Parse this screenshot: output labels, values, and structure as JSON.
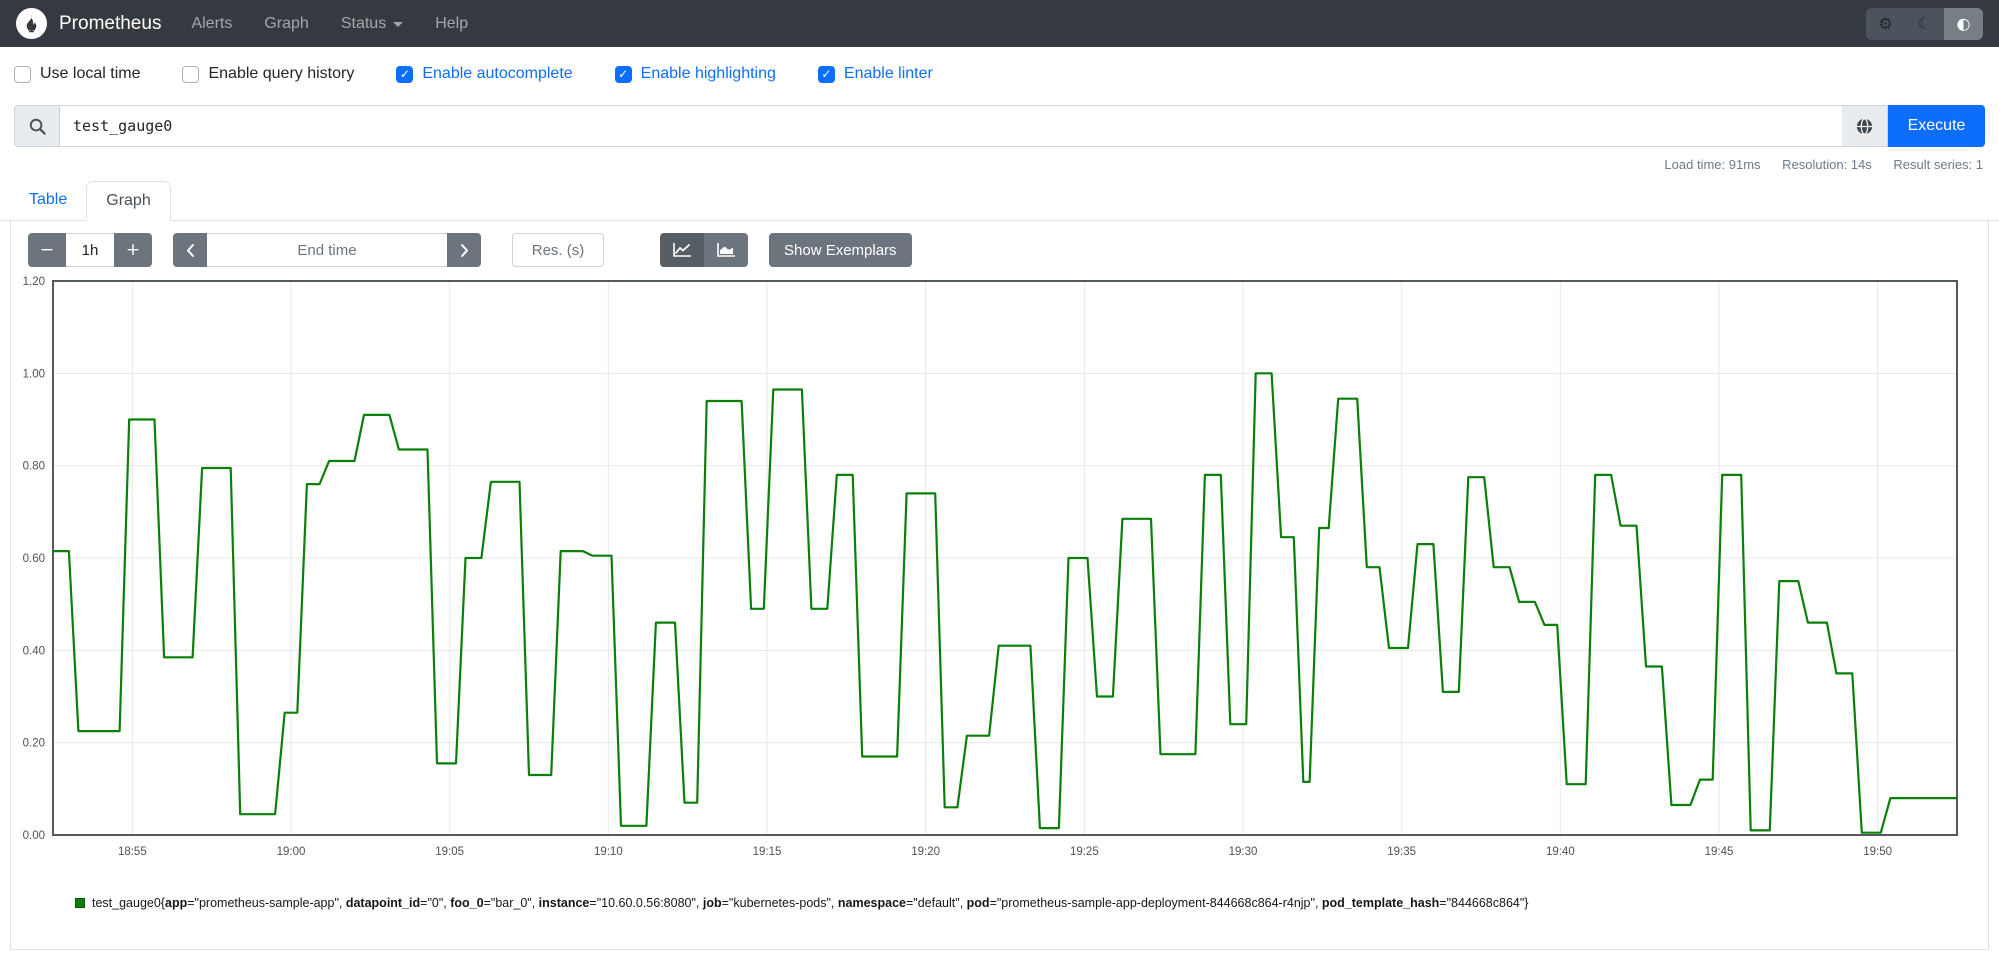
{
  "navbar": {
    "brand": "Prometheus",
    "items": [
      {
        "label": "Alerts",
        "dropdown": false
      },
      {
        "label": "Graph",
        "dropdown": false
      },
      {
        "label": "Status",
        "dropdown": true
      },
      {
        "label": "Help",
        "dropdown": false
      }
    ],
    "theme_buttons": [
      {
        "icon": "gear-icon",
        "glyph": "⚙",
        "active": false
      },
      {
        "icon": "moon-icon",
        "glyph": "☾",
        "active": false
      },
      {
        "icon": "auto-contrast-icon",
        "glyph": "◐",
        "active": true
      }
    ]
  },
  "options": {
    "items": [
      {
        "label": "Use local time",
        "checked": false
      },
      {
        "label": "Enable query history",
        "checked": false
      },
      {
        "label": "Enable autocomplete",
        "checked": true
      },
      {
        "label": "Enable highlighting",
        "checked": true
      },
      {
        "label": "Enable linter",
        "checked": true
      }
    ]
  },
  "query": {
    "value": "test_gauge0",
    "execute_label": "Execute"
  },
  "stats": {
    "load_time": "Load time: 91ms",
    "resolution": "Resolution: 14s",
    "result_series": "Result series: 1"
  },
  "tabs": [
    {
      "label": "Table",
      "active": false
    },
    {
      "label": "Graph",
      "active": true
    }
  ],
  "controls": {
    "range_decrease_label": "−",
    "range_value": "1h",
    "range_increase_label": "+",
    "end_time_placeholder": "End time",
    "res_placeholder": "Res. (s)",
    "show_exemplars_label": "Show Exemplars"
  },
  "colors": {
    "accent_blue": "#0d6efd",
    "navbar_bg": "#343a40",
    "series_green": "#0a7f0a",
    "button_grey": "#6c757d"
  },
  "chart_data": {
    "type": "line",
    "step": true,
    "title": "",
    "xlabel": "",
    "ylabel": "",
    "grid": true,
    "legend_position": "bottom",
    "ylim": [
      0,
      1.2
    ],
    "y_ticks": [
      "0.00",
      "0.20",
      "0.40",
      "0.60",
      "0.80",
      "1.00",
      "1.20"
    ],
    "x_range_min": [
      0,
      60
    ],
    "x_ticks": [
      {
        "offset_min": 2.5,
        "label": "18:55"
      },
      {
        "offset_min": 7.5,
        "label": "19:00"
      },
      {
        "offset_min": 12.5,
        "label": "19:05"
      },
      {
        "offset_min": 17.5,
        "label": "19:10"
      },
      {
        "offset_min": 22.5,
        "label": "19:15"
      },
      {
        "offset_min": 27.5,
        "label": "19:20"
      },
      {
        "offset_min": 32.5,
        "label": "19:25"
      },
      {
        "offset_min": 37.5,
        "label": "19:30"
      },
      {
        "offset_min": 42.5,
        "label": "19:35"
      },
      {
        "offset_min": 47.5,
        "label": "19:40"
      },
      {
        "offset_min": 52.5,
        "label": "19:45"
      },
      {
        "offset_min": 57.5,
        "label": "19:50"
      }
    ],
    "series": [
      {
        "name": "test_gauge0{app=\"prometheus-sample-app\", datapoint_id=\"0\", foo_0=\"bar_0\", instance=\"10.60.0.56:8080\", job=\"kubernetes-pods\", namespace=\"default\", pod=\"prometheus-sample-app-deployment-844668c864-r4njp\", pod_template_hash=\"844668c864\"}",
        "color": "#0a7f0a",
        "segments": [
          [
            0.0,
            0.615
          ],
          [
            0.8,
            0.225
          ],
          [
            2.4,
            0.9
          ],
          [
            3.5,
            0.385
          ],
          [
            4.7,
            0.795
          ],
          [
            5.9,
            0.045
          ],
          [
            7.3,
            0.265
          ],
          [
            8.0,
            0.76
          ],
          [
            8.7,
            0.81
          ],
          [
            9.8,
            0.91
          ],
          [
            10.9,
            0.835
          ],
          [
            12.1,
            0.155
          ],
          [
            13.0,
            0.6
          ],
          [
            13.8,
            0.765
          ],
          [
            15.0,
            0.13
          ],
          [
            16.0,
            0.615
          ],
          [
            17.0,
            0.605
          ],
          [
            17.9,
            0.02
          ],
          [
            19.0,
            0.46
          ],
          [
            19.9,
            0.07
          ],
          [
            20.6,
            0.94
          ],
          [
            22.0,
            0.49
          ],
          [
            22.7,
            0.965
          ],
          [
            23.9,
            0.49
          ],
          [
            24.7,
            0.78
          ],
          [
            25.5,
            0.17
          ],
          [
            26.9,
            0.74
          ],
          [
            28.1,
            0.06
          ],
          [
            28.8,
            0.215
          ],
          [
            29.8,
            0.41
          ],
          [
            31.1,
            0.015
          ],
          [
            32.0,
            0.6
          ],
          [
            32.9,
            0.3
          ],
          [
            33.7,
            0.685
          ],
          [
            34.9,
            0.175
          ],
          [
            36.3,
            0.78
          ],
          [
            37.1,
            0.24
          ],
          [
            37.9,
            1.0
          ],
          [
            38.7,
            0.645
          ],
          [
            39.4,
            0.115
          ],
          [
            39.9,
            0.665
          ],
          [
            40.5,
            0.945
          ],
          [
            41.4,
            0.58
          ],
          [
            42.1,
            0.405
          ],
          [
            43.0,
            0.63
          ],
          [
            43.8,
            0.31
          ],
          [
            44.6,
            0.775
          ],
          [
            45.4,
            0.58
          ],
          [
            46.2,
            0.505
          ],
          [
            47.0,
            0.455
          ],
          [
            47.7,
            0.11
          ],
          [
            48.6,
            0.78
          ],
          [
            49.4,
            0.67
          ],
          [
            50.2,
            0.365
          ],
          [
            51.0,
            0.065
          ],
          [
            51.9,
            0.12
          ],
          [
            52.6,
            0.78
          ],
          [
            53.5,
            0.01
          ],
          [
            54.4,
            0.55
          ],
          [
            55.3,
            0.46
          ],
          [
            56.2,
            0.35
          ],
          [
            57.0,
            0.005
          ],
          [
            57.9,
            0.08
          ]
        ]
      }
    ]
  },
  "legend": {
    "metric": "test_gauge0",
    "labels": [
      {
        "name": "app",
        "value": "prometheus-sample-app"
      },
      {
        "name": "datapoint_id",
        "value": "0"
      },
      {
        "name": "foo_0",
        "value": "bar_0"
      },
      {
        "name": "instance",
        "value": "10.60.0.56:8080"
      },
      {
        "name": "job",
        "value": "kubernetes-pods"
      },
      {
        "name": "namespace",
        "value": "default"
      },
      {
        "name": "pod",
        "value": "prometheus-sample-app-deployment-844668c864-r4njp"
      },
      {
        "name": "pod_template_hash",
        "value": "844668c864"
      }
    ]
  }
}
